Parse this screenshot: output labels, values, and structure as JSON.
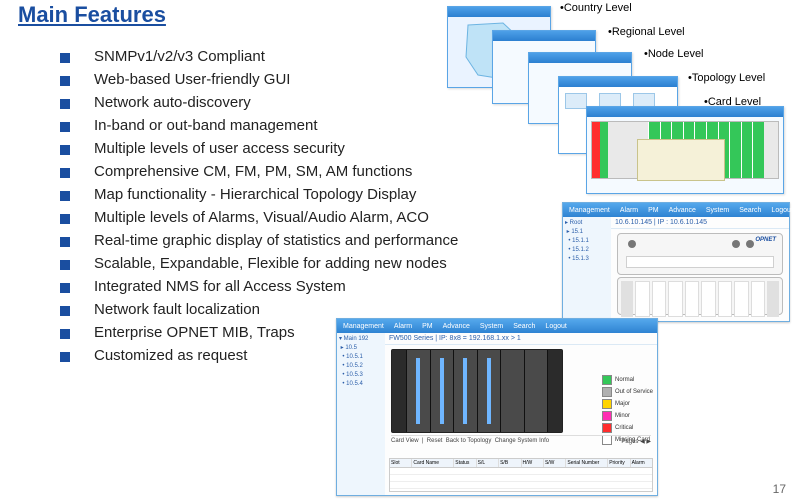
{
  "title": "Main Features",
  "bullets": [
    "SNMPv1/v2/v3 Compliant",
    "Web-based User-friendly GUI",
    "Network auto-discovery",
    "In-band or out-band management",
    "Multiple levels of user access security",
    "Comprehensive CM, FM, PM, SM, AM functions",
    "Map functionality - Hierarchical Topology Display",
    "Multiple levels of Alarms, Visual/Audio Alarm, ACO",
    "Real-time graphic display of statistics and performance",
    "Scalable, Expandable, Flexible for adding new nodes",
    "Integrated NMS for all  Access System",
    "Network fault localization",
    "Enterprise OPNET MIB, Traps",
    "Customized as request"
  ],
  "levels": {
    "country": "•Country Level",
    "regional": "•Regional Level",
    "node": "•Node Level",
    "topology": "•Topology Level",
    "card": "•Card Level"
  },
  "app_menu": [
    "Management",
    "Alarm",
    "PM",
    "Advance",
    "System",
    "Search",
    "Logout"
  ],
  "app_breadcrumb_top": "10.6.10.145 | IP : 10.6.10.145",
  "app_breadcrumb_bottom": "FW500 Series | IP: 8x8 = 192.168.1.xx > 1",
  "device_label": "OPNET",
  "legend": {
    "normal": {
      "label": "Normal",
      "color": "#34c759"
    },
    "outsvc": {
      "label": "Out of Service",
      "color": "#b0b0b0"
    },
    "major": {
      "label": "Major",
      "color": "#ffd400"
    },
    "minor": {
      "label": "Minor",
      "color": "#ff2fb3"
    },
    "critical": {
      "label": "Critical",
      "color": "#ff2d2d"
    },
    "missing": {
      "label": "Missing Card",
      "color": "#ffffff"
    }
  },
  "table_headers": [
    "Slot",
    "Card Name",
    "Status",
    "S/L",
    "S/B",
    "H/W",
    "S/W",
    "Serial Number",
    "Priority",
    "Alarm"
  ],
  "page_number": "17"
}
